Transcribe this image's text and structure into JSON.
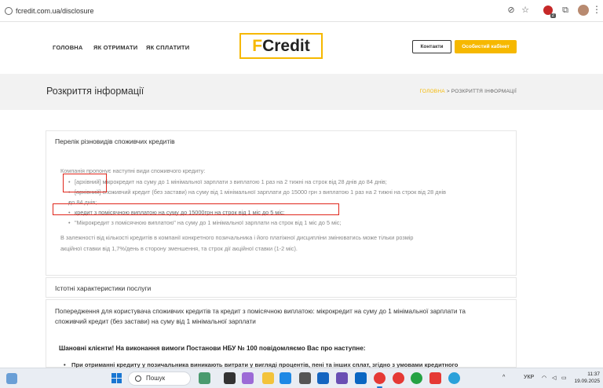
{
  "browser": {
    "url": "fcredit.com.ua/disclosure",
    "extension_badge_count": "2"
  },
  "header": {
    "nav": [
      "ГОЛОВНА",
      "ЯК ОТРИМАТИ",
      "ЯК СПЛАТИТИ"
    ],
    "logo_accent": "F",
    "logo_rest": "Credit",
    "contacts_label": "Контакти",
    "cabinet_label": "Особистий кабінет"
  },
  "title_band": {
    "title": "Розкриття інформації",
    "breadcrumb_home": "ГОЛОВНА",
    "breadcrumb_sep": ">",
    "breadcrumb_current": "РОЗКРИТТЯ ІНФОРМАЦІЇ"
  },
  "card_types": {
    "title": "Перелік різновидів споживчих кредитів",
    "intro": "Компанія пропонує наступні види споживчого кредиту:",
    "items": [
      "[архівний] мікрокредит на суму до 1 мінімальної зарплати з виплатою 1 раз на 2 тижні на строк від 28 днів до 84 днів;",
      "[архівний] споживчий кредит (без застави) на суму від 1 мінімальної зарплати до 15000 грн з виплатою 1 раз на 2 тижні на строк від 28 днів",
      "до 84 днів;",
      "кредит з помісячною виплатою на суму до 15000грн на строк від 1 міс до 5 міс;",
      "\"Мікрокредит з помісячною виплатою\" на суму до 1 мінімальної зарплати на строк від 1 міс до 5 міс;"
    ],
    "note_line1": "В залежності від кількості кредитів в компанії конкретного позичальника і його платіжної дисципліни змінюватись може тільки розмір",
    "note_line2": "акційної ставки від 1,7%/день в сторону зменшення, та строк дії акційної ставки (1-2 міс)."
  },
  "card_features": {
    "title": "Істотні характеристики послуги"
  },
  "card_warning": {
    "text_line1": "Попередження для користувача споживчих кредитів та кредит з помісячною виплатою: мікрокредит на суму до 1 мінімальної зарплати та",
    "text_line2": "споживчий кредит (без застави) на суму від 1 мінімальної зарплати",
    "notice_title": "Шановні клієнти! На виконання вимоги Постанови НБУ № 100 повідомляємо Вас про наступне:",
    "notice_item": "При отриманні кредиту у позичальника виникають витрати у вигляді процентів, пені та інших сплат, згідно з умовами кредитного"
  },
  "taskbar": {
    "search_label": "Пошук",
    "language": "УКР",
    "time": "11:37",
    "date": "19.09.2025"
  },
  "colors": {
    "accent": "#f6b800",
    "highlight_box": "#e0261b"
  }
}
